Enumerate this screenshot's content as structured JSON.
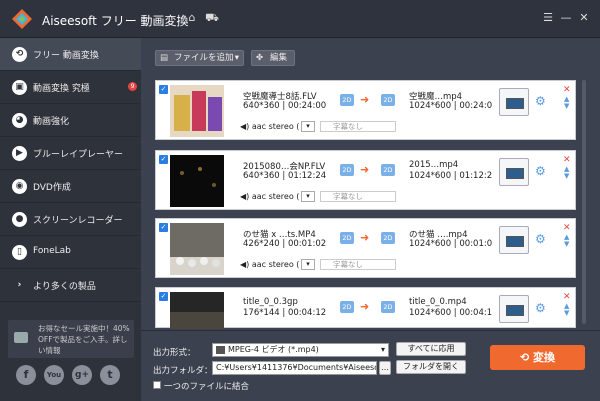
{
  "app": {
    "title": "Aiseesoft フリー 動画変換"
  },
  "titlebar_icons": [
    "home-icon",
    "cart-icon",
    "feedback-icon",
    "minimize-icon",
    "close-icon"
  ],
  "sidebar": {
    "items": [
      {
        "label": "フリー 動画変換",
        "icon": "convert-icon",
        "active": true
      },
      {
        "label": "動画変換 究極",
        "icon": "film-icon",
        "badge": "9"
      },
      {
        "label": "動画強化",
        "icon": "palette-icon"
      },
      {
        "label": "ブルーレイプレーヤー",
        "icon": "play-icon"
      },
      {
        "label": "DVD作成",
        "icon": "disc-icon"
      },
      {
        "label": "スクリーンレコーダー",
        "icon": "camera-icon"
      },
      {
        "label": "FoneLab",
        "icon": "phone-icon"
      },
      {
        "label": "より多くの製品",
        "icon": "chevron-right-icon"
      }
    ],
    "promo": "お得なセール実施中！40% OFFで製品をご入手。詳しい情報",
    "social": [
      "f",
      "You",
      "g+",
      "t"
    ]
  },
  "toolbar": {
    "add_file": "ファイルを追加",
    "edit": "編集"
  },
  "files": [
    {
      "src_name": "空戦魔導士8話.FLV",
      "src_info": "640*360 | 00:24:00",
      "tgt_name": "空戦魔…mp4",
      "tgt_info": "1024*600 | 00:24:0",
      "audio": "aac stereo (",
      "subtitle": "字幕なし",
      "badge": "2D"
    },
    {
      "src_name": "2015080…会NP.FLV",
      "src_info": "640*360 | 01:12:24",
      "tgt_name": "2015…mp4",
      "tgt_info": "1024*600 | 01:12:2",
      "audio": "aac stereo (",
      "subtitle": "字幕なし",
      "badge": "2D"
    },
    {
      "src_name": "のせ猫 x …ts.MP4",
      "src_info": "426*240 | 00:01:02",
      "tgt_name": "のせ猫 ….mp4",
      "tgt_info": "1024*600 | 00:01:0",
      "audio": "aac stereo (",
      "subtitle": "字幕なし",
      "badge": "2D"
    },
    {
      "src_name": "title_0_0.3gp",
      "src_info": "176*144 | 00:04:12",
      "tgt_name": "title_0_0.mp4",
      "tgt_info": "1024*600 | 00:04:1",
      "audio": "",
      "subtitle": "",
      "badge": "2D"
    }
  ],
  "bottom": {
    "format_label": "出力形式：",
    "format_value": "MPEG-4 ビデオ (*.mp4)",
    "apply_all": "すべてに応用",
    "folder_label": "出力フォルダ：",
    "folder_value": "C:¥Users¥1411376¥Documents¥Aiseesof",
    "folder_more": "…",
    "open_folder": "フォルダを開く",
    "merge": "一つのファイルに結合",
    "convert": "変換"
  },
  "colors": {
    "accent": "#f06a30",
    "checkbox": "#2a7de1",
    "sidebar_bg": "#2e323b",
    "main_bg": "#3c4150"
  }
}
